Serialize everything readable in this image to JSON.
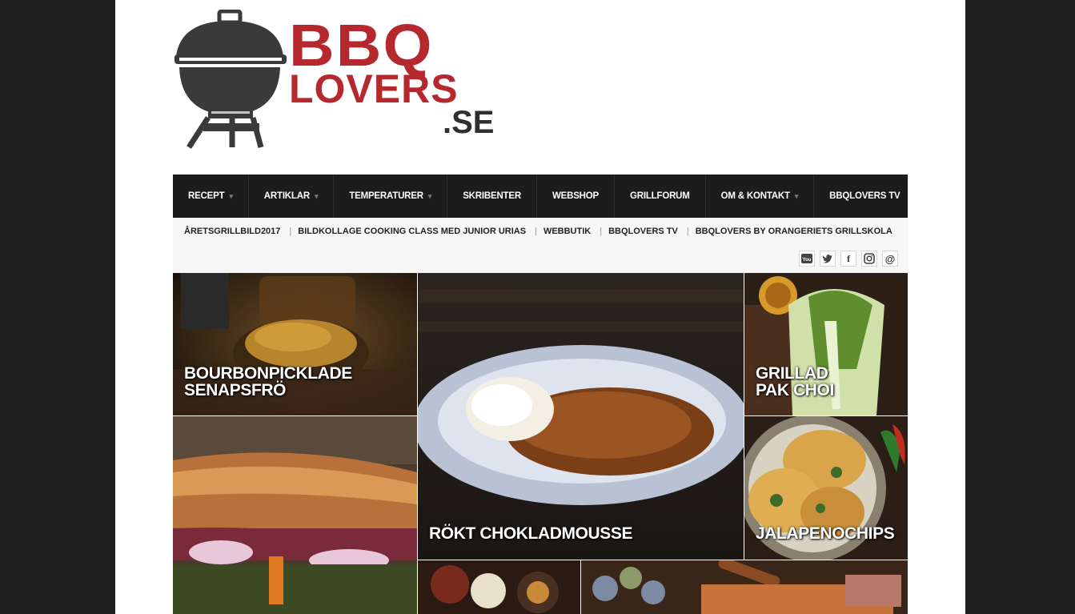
{
  "logo": {
    "line1": "BBQ",
    "line2": "LOVERS",
    "line3": ".SE"
  },
  "mainnav": [
    {
      "label": "RECEPT",
      "has_dropdown": true
    },
    {
      "label": "ARTIKLAR",
      "has_dropdown": true
    },
    {
      "label": "TEMPERATURER",
      "has_dropdown": true
    },
    {
      "label": "SKRIBENTER",
      "has_dropdown": false
    },
    {
      "label": "WEBSHOP",
      "has_dropdown": false
    },
    {
      "label": "GRILLFORUM",
      "has_dropdown": false
    },
    {
      "label": "OM & KONTAKT",
      "has_dropdown": true
    },
    {
      "label": "BBQLOVERS TV",
      "has_dropdown": false
    }
  ],
  "subnav": [
    "ÅRETSGRILLBILD2017",
    "BILDKOLLAGE COOKING CLASS MED JUNIOR URIAS",
    "WEBBUTIK",
    "BBQLOVERS TV",
    "BBQLOVERS BY ORANGERIETS GRILLSKOLA"
  ],
  "social": {
    "youtube": "You Tube",
    "twitter": "twitter-icon",
    "facebook": "f",
    "instagram": "instagram-icon",
    "email": "@"
  },
  "tiles": {
    "t1": {
      "line1": "BOURBONPICKLADE",
      "line2": "SENAPSFRÖ"
    },
    "t2": {
      "line1": "RÖKT CHOKLADMOUSSE"
    },
    "t3": {
      "line1": "GRILLAD",
      "line2": "PAK CHOI"
    },
    "t4": {
      "line1": "JALAPENOCHIPS"
    }
  },
  "colors": {
    "brand_red": "#b5282e",
    "nav_bg": "#1c1c1c",
    "outer_bg": "#1f1f1f"
  }
}
